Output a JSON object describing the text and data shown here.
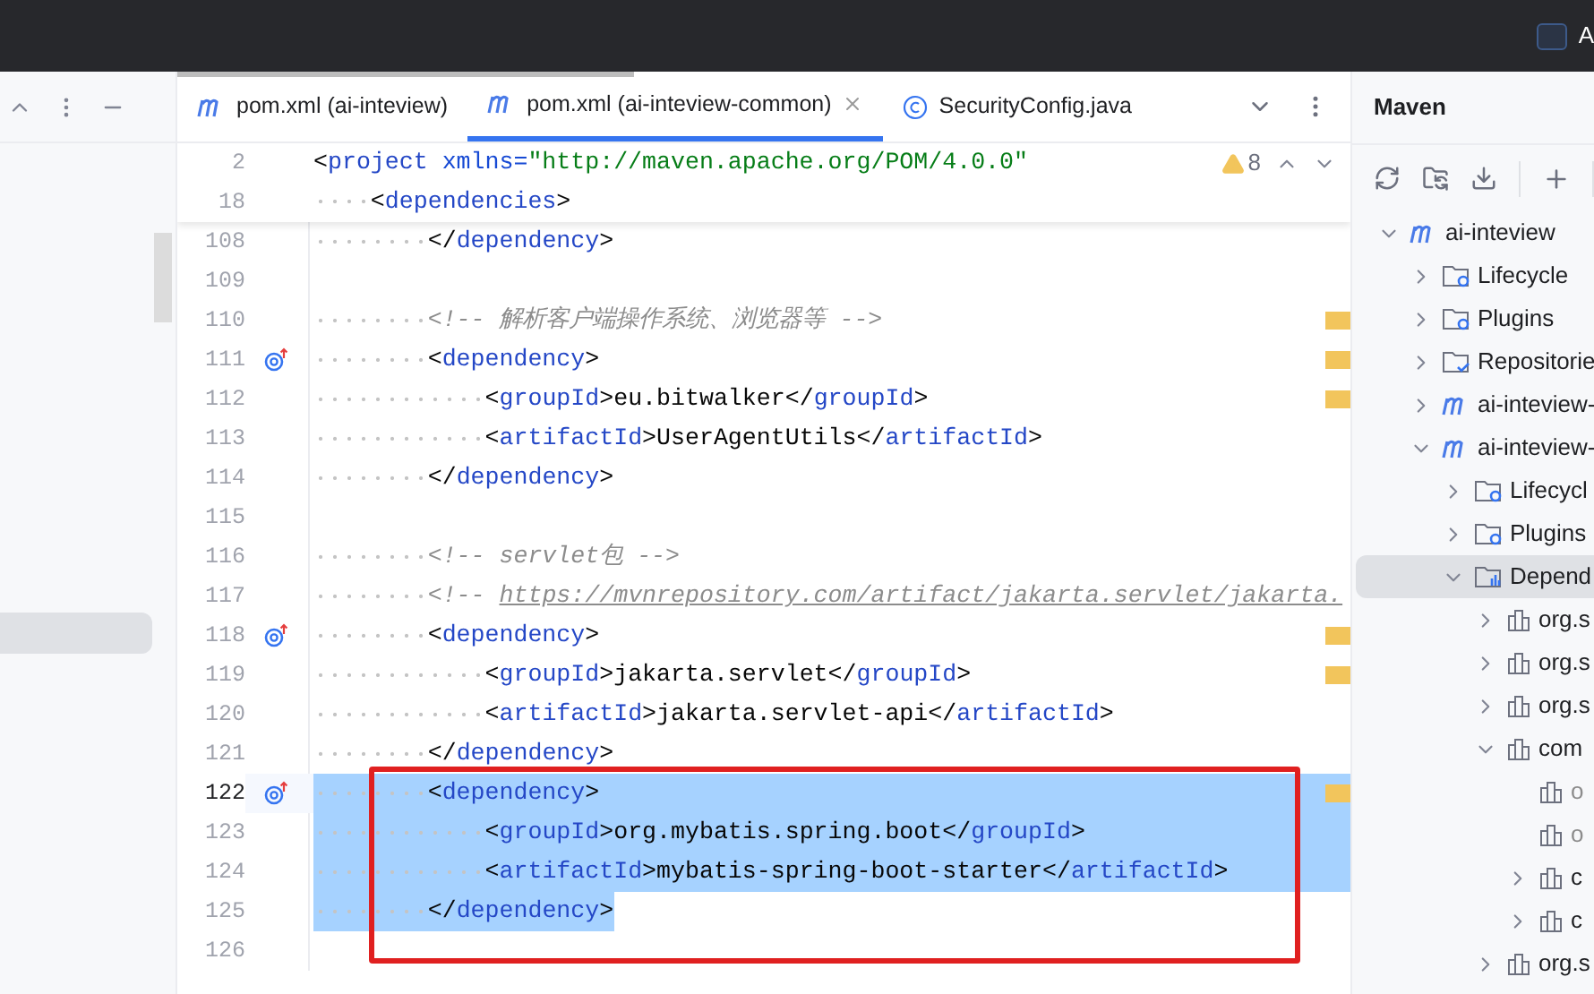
{
  "top_bar": {
    "label": "A"
  },
  "left_panel": {
    "has_selected_row": true
  },
  "tabs": [
    {
      "label": "pom.xml (ai-inteview)",
      "kind": "maven",
      "selected": false,
      "closable": false
    },
    {
      "label": "pom.xml (ai-inteview-common)",
      "kind": "maven",
      "selected": true,
      "closable": true
    },
    {
      "label": "SecurityConfig.java",
      "kind": "class",
      "selected": false,
      "closable": false
    }
  ],
  "inspections": {
    "warnings": "8"
  },
  "sticky_lines": [
    {
      "number": "2",
      "text": "<project xmlns=\"http://maven.apache.org/POM/4.0.0\""
    },
    {
      "number": "18",
      "text": "    <dependencies>"
    }
  ],
  "lines": [
    {
      "number": "108",
      "text": "        </dependency>",
      "gutter_icon": false,
      "stripe_mark": false,
      "selected": false,
      "current": false
    },
    {
      "number": "109",
      "gutter_icon": false,
      "stripe_mark": false,
      "selected": false,
      "current": false
    },
    {
      "number": "110",
      "text": "        <!-- 解析客户端操作系统、浏览器等 -->",
      "gutter_icon": false,
      "stripe_mark": true,
      "selected": false,
      "current": false
    },
    {
      "number": "111",
      "text": "        <dependency>",
      "gutter_icon": true,
      "stripe_mark": true,
      "selected": false,
      "current": false
    },
    {
      "number": "112",
      "text": "            <groupId>eu.bitwalker</groupId>",
      "gutter_icon": false,
      "stripe_mark": true,
      "selected": false,
      "current": false
    },
    {
      "number": "113",
      "text": "            <artifactId>UserAgentUtils</artifactId>",
      "gutter_icon": false,
      "stripe_mark": false,
      "selected": false,
      "current": false
    },
    {
      "number": "114",
      "text": "        </dependency>",
      "gutter_icon": false,
      "stripe_mark": false,
      "selected": false,
      "current": false
    },
    {
      "number": "115",
      "gutter_icon": false,
      "stripe_mark": false,
      "selected": false,
      "current": false
    },
    {
      "number": "116",
      "text": "        <!-- servlet包 -->",
      "gutter_icon": false,
      "stripe_mark": false,
      "selected": false,
      "current": false
    },
    {
      "number": "117",
      "text": "        <!-- https://mvnrepository.com/artifact/jakarta.servlet/jakarta.",
      "gutter_icon": false,
      "stripe_mark": false,
      "selected": false,
      "current": false
    },
    {
      "number": "118",
      "text": "        <dependency>",
      "gutter_icon": true,
      "stripe_mark": true,
      "selected": false,
      "current": false
    },
    {
      "number": "119",
      "text": "            <groupId>jakarta.servlet</groupId>",
      "gutter_icon": false,
      "stripe_mark": true,
      "selected": false,
      "current": false
    },
    {
      "number": "120",
      "text": "            <artifactId>jakarta.servlet-api</artifactId>",
      "gutter_icon": false,
      "stripe_mark": false,
      "selected": false,
      "current": false
    },
    {
      "number": "121",
      "text": "        </dependency>",
      "gutter_icon": false,
      "stripe_mark": false,
      "selected": false,
      "current": false
    },
    {
      "number": "122",
      "text": "        <dependency>",
      "gutter_icon": true,
      "stripe_mark": true,
      "selected": true,
      "current": true
    },
    {
      "number": "123",
      "text": "            <groupId>org.mybatis.spring.boot</groupId>",
      "gutter_icon": false,
      "stripe_mark": false,
      "selected": true,
      "current": false
    },
    {
      "number": "124",
      "text": "            <artifactId>mybatis-spring-boot-starter</artifactId>",
      "gutter_icon": false,
      "stripe_mark": false,
      "selected": true,
      "current": false
    },
    {
      "number": "125",
      "text": "        </dependency>",
      "gutter_icon": false,
      "stripe_mark": false,
      "selected": true,
      "current": false
    },
    {
      "number": "126",
      "gutter_icon": false,
      "stripe_mark": false,
      "selected": false,
      "current": false
    }
  ],
  "maven": {
    "title": "Maven",
    "tree": [
      {
        "label": "ai-inteview",
        "kind": "module",
        "expanded": true,
        "selected": false,
        "muted": false,
        "children": [
          {
            "label": "Lifecycle",
            "kind": "lifecycle",
            "expanded": false,
            "selected": false,
            "muted": false
          },
          {
            "label": "Plugins",
            "kind": "plugins",
            "expanded": false,
            "selected": false,
            "muted": false
          },
          {
            "label": "Repositorie",
            "kind": "repositories",
            "expanded": false,
            "selected": false,
            "muted": false
          },
          {
            "label": "ai-inteview-",
            "kind": "module",
            "expanded": false,
            "selected": false,
            "muted": false
          },
          {
            "label": "ai-inteview-",
            "kind": "module",
            "expanded": true,
            "selected": false,
            "muted": false,
            "children": [
              {
                "label": "Lifecycl",
                "kind": "lifecycle",
                "expanded": false,
                "selected": false,
                "muted": false
              },
              {
                "label": "Plugins",
                "kind": "plugins",
                "expanded": false,
                "selected": false,
                "muted": false
              },
              {
                "label": "Depend",
                "kind": "dependencies",
                "expanded": true,
                "selected": true,
                "muted": false,
                "children": [
                  {
                    "label": "org.s",
                    "kind": "library",
                    "expanded": false,
                    "selected": false,
                    "muted": false
                  },
                  {
                    "label": "org.s",
                    "kind": "library",
                    "expanded": false,
                    "selected": false,
                    "muted": false
                  },
                  {
                    "label": "org.s",
                    "kind": "library",
                    "expanded": false,
                    "selected": false,
                    "muted": false
                  },
                  {
                    "label": "com",
                    "kind": "library",
                    "expanded": true,
                    "selected": false,
                    "muted": false,
                    "children": [
                      {
                        "label": "o",
                        "kind": "leaf",
                        "expanded": false,
                        "selected": false,
                        "muted": true
                      },
                      {
                        "label": "o",
                        "kind": "leaf",
                        "expanded": false,
                        "selected": false,
                        "muted": true
                      },
                      {
                        "label": "c",
                        "kind": "library",
                        "expanded": false,
                        "selected": false,
                        "muted": false
                      },
                      {
                        "label": "c",
                        "kind": "library",
                        "expanded": false,
                        "selected": false,
                        "muted": false
                      }
                    ]
                  },
                  {
                    "label": "org.s",
                    "kind": "library",
                    "expanded": false,
                    "selected": false,
                    "muted": false
                  }
                ]
              }
            ]
          }
        ]
      }
    ]
  }
}
